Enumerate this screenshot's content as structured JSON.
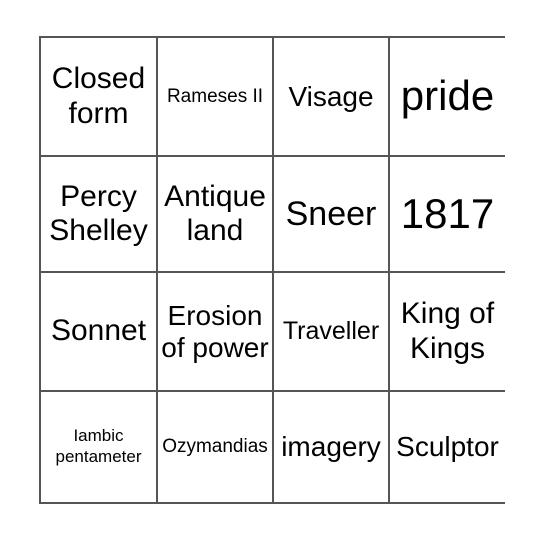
{
  "card": {
    "type": "bingo-card",
    "rows": 4,
    "columns": 4,
    "border_color": "#555555",
    "background_color": "#ffffff",
    "text_color": "#000000",
    "cells": [
      {
        "text": "Closed form",
        "size": "sz-l"
      },
      {
        "text": "Rameses II",
        "size": "sz-s"
      },
      {
        "text": "Visage",
        "size": "sz-ml"
      },
      {
        "text": "pride",
        "size": "sz-xxl"
      },
      {
        "text": "Percy Shelley",
        "size": "sz-l"
      },
      {
        "text": "Antique land",
        "size": "sz-l"
      },
      {
        "text": "Sneer",
        "size": "sz-xl"
      },
      {
        "text": "1817",
        "size": "sz-xxl"
      },
      {
        "text": "Sonnet",
        "size": "sz-l"
      },
      {
        "text": "Erosion of power",
        "size": "sz-ml"
      },
      {
        "text": "Traveller",
        "size": "sz-m"
      },
      {
        "text": "King of Kings",
        "size": "sz-l"
      },
      {
        "text": "Iambic pentameter",
        "size": "sz-xs"
      },
      {
        "text": "Ozymandias",
        "size": "sz-s"
      },
      {
        "text": "imagery",
        "size": "sz-ml"
      },
      {
        "text": "Sculptor",
        "size": "sz-ml"
      }
    ]
  }
}
